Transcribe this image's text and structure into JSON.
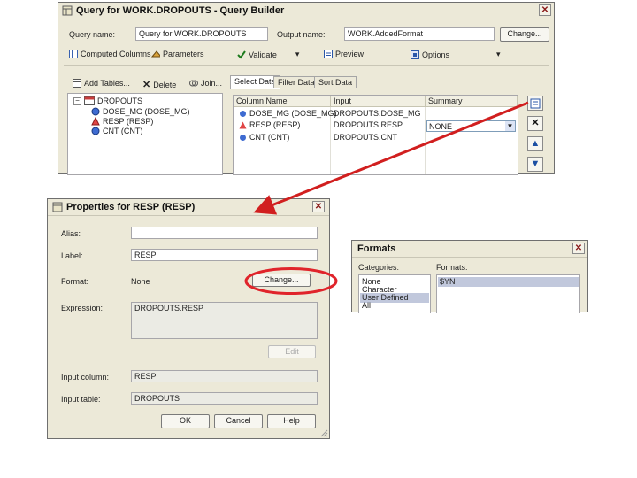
{
  "query_builder": {
    "title": "Query for WORK.DROPOUTS - Query Builder",
    "query_name_label": "Query name:",
    "query_name_value": "Query for WORK.DROPOUTS",
    "output_name_label": "Output name:",
    "output_name_value": "WORK.AddedFormat",
    "change_label": "Change...",
    "toolbar": {
      "computed_columns": "Computed Columns",
      "parameters": "Parameters",
      "validate": "Validate",
      "preview": "Preview",
      "options": "Options"
    },
    "left_toolbar": {
      "add_tables": "Add Tables...",
      "delete": "Delete",
      "join": "Join..."
    },
    "tree": {
      "table": "DROPOUTS",
      "columns": [
        "DOSE_MG (DOSE_MG)",
        "RESP (RESP)",
        "CNT (CNT)"
      ]
    },
    "tabs": [
      "Select Data",
      "Filter Data",
      "Sort Data"
    ],
    "grid": {
      "headers": [
        "Column Name",
        "Input",
        "Summary"
      ],
      "rows": [
        {
          "name": "DOSE_MG (DOSE_MG)",
          "input": "DROPOUTS.DOSE_MG",
          "summary": ""
        },
        {
          "name": "RESP (RESP)",
          "input": "DROPOUTS.RESP",
          "summary": "NONE"
        },
        {
          "name": "CNT (CNT)",
          "input": "DROPOUTS.CNT",
          "summary": ""
        }
      ]
    }
  },
  "properties": {
    "title": "Properties for RESP (RESP)",
    "alias_label": "Alias:",
    "alias_value": "",
    "label_label": "Label:",
    "label_value": "RESP",
    "format_label": "Format:",
    "format_value": "None",
    "change_label": "Change...",
    "expression_label": "Expression:",
    "expression_value": "DROPOUTS.RESP",
    "edit_label": "Edit",
    "input_column_label": "Input column:",
    "input_column_value": "RESP",
    "input_table_label": "Input table:",
    "input_table_value": "DROPOUTS",
    "ok_label": "OK",
    "cancel_label": "Cancel",
    "help_label": "Help"
  },
  "formats": {
    "title": "Formats",
    "categories_label": "Categories:",
    "categories": [
      "None",
      "Character",
      "User Defined",
      "All"
    ],
    "selected_category": "User Defined",
    "formats_label": "Formats:",
    "formats": [
      "$YN"
    ],
    "selected_format": "$YN"
  },
  "colors": {
    "window_bg": "#ece9d8",
    "highlight_ring": "#e0242b",
    "arrow": "#d11f1f",
    "selection": "#c1c8dc"
  }
}
